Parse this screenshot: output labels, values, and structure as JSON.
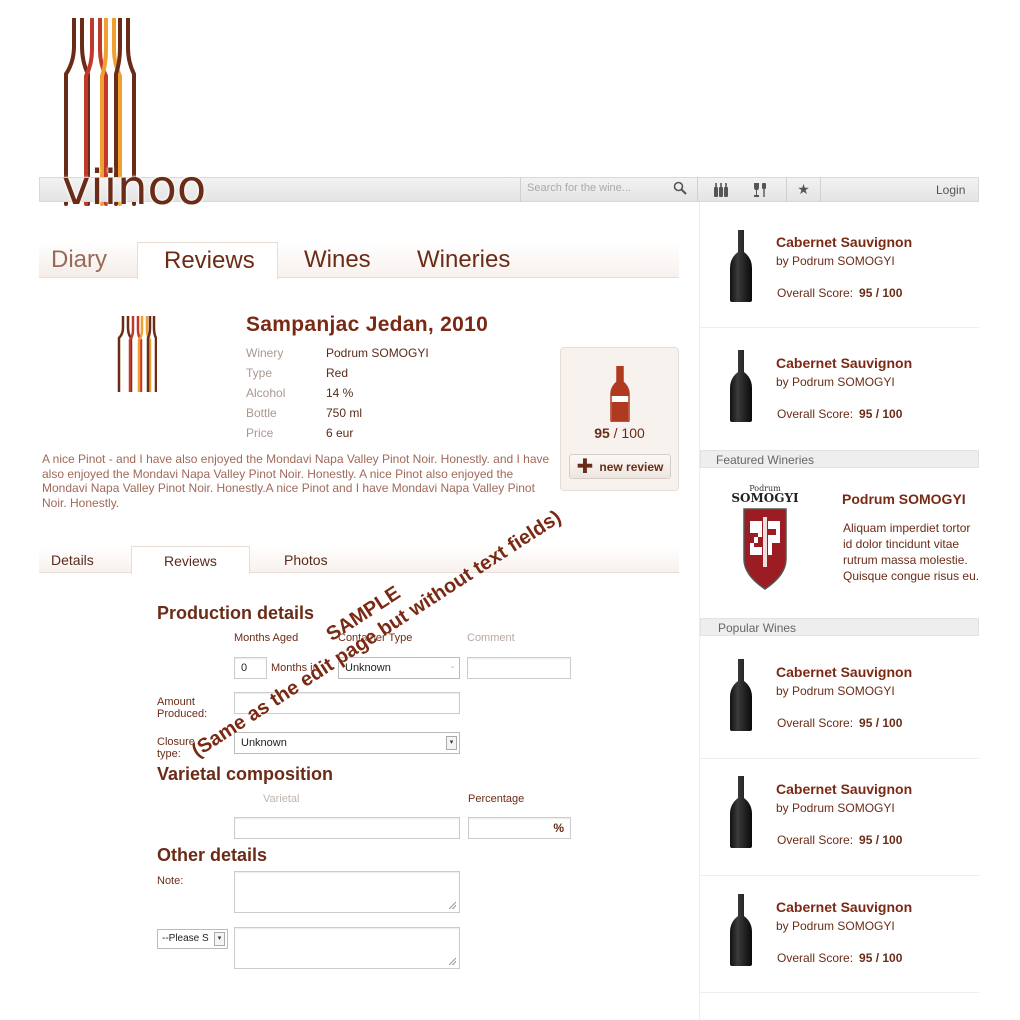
{
  "brand": {
    "name": "viinoo"
  },
  "topbar": {
    "search_placeholder": "Search for the wine...",
    "login_label": "Login",
    "icons": [
      "search-icon",
      "bottles-icon",
      "glasses-icon",
      "star-icon"
    ]
  },
  "tabs": [
    {
      "label": "Diary"
    },
    {
      "label": "Reviews"
    },
    {
      "label": "Wines"
    },
    {
      "label": "Wineries"
    }
  ],
  "wine": {
    "title": "Sampanjac Jedan, 2010",
    "fields": [
      {
        "label": "Winery",
        "value": "Podrum SOMOGYI"
      },
      {
        "label": "Type",
        "value": "Red"
      },
      {
        "label": "Alcohol",
        "value": "14 %"
      },
      {
        "label": "Bottle",
        "value": "750 ml"
      },
      {
        "label": "Price",
        "value": "6 eur"
      }
    ],
    "description": "A nice Pinot - and I have also enjoyed the Mondavi Napa Valley Pinot Noir. Honestly. and I have also enjoyed the Mondavi Napa Valley Pinot Noir. Honestly. A nice Pinot also enjoyed the Mondavi Napa Valley Pinot Noir. Honestly.A nice Pinot and I have Mondavi Napa Valley Pinot Noir. Honestly.",
    "score": "95",
    "score_max": "/ 100",
    "new_review_label": "new review"
  },
  "subtabs": [
    {
      "label": "Details"
    },
    {
      "label": "Reviews"
    },
    {
      "label": "Photos"
    }
  ],
  "form": {
    "production_title": "Production details",
    "months_aged_label": "Months Aged",
    "container_type_label": "Container Type",
    "comment_label": "Comment",
    "months_value": "0",
    "months_in_label": "Months in",
    "container_value": "Unknown",
    "amount_label_1": "Amount",
    "amount_label_2": "Produced:",
    "closure_label_1": "Closure",
    "closure_label_2": "type:",
    "closure_value": "Unknown",
    "varietal_title": "Varietal composition",
    "varietal_label": "Varietal",
    "percentage_label": "Percentage",
    "percent_sign": "%",
    "other_title": "Other details",
    "note_label": "Note:",
    "please_select": "--Please S"
  },
  "watermark": {
    "line1": "SAMPLE",
    "line2": "(Same as the edit page but without text fields)"
  },
  "sidebar": {
    "wine_score_label": "Overall Score:",
    "top_wines": [
      {
        "name": "Cabernet Sauvignon",
        "winery": "by Podrum SOMOGYI",
        "score": "95 / 100"
      },
      {
        "name": "Cabernet Sauvignon",
        "winery": "by Podrum SOMOGYI",
        "score": "95 / 100"
      }
    ],
    "featured_header": "Featured Wineries",
    "featured": {
      "logo_text": "Podrum",
      "logo_brand": "SOMOGYI",
      "name": "Podrum SOMOGYI",
      "description": "Aliquam imperdiet tortor id dolor tincidunt vitae rutrum massa molestie. Quisque congue risus eu."
    },
    "popular_header": "Popular Wines",
    "popular_wines": [
      {
        "name": "Cabernet Sauvignon",
        "winery": "by Podrum SOMOGYI",
        "score": "95 / 100"
      },
      {
        "name": "Cabernet Sauvignon",
        "winery": "by Podrum SOMOGYI",
        "score": "95 / 100"
      },
      {
        "name": "Cabernet Sauvignon",
        "winery": "by Podrum SOMOGYI",
        "score": "95 / 100"
      }
    ]
  },
  "colors": {
    "brand_dark": "#6b2c17",
    "bottle_red": "#c0392b",
    "bottle_orange": "#e67e22",
    "bottle_amber": "#f0a030"
  }
}
